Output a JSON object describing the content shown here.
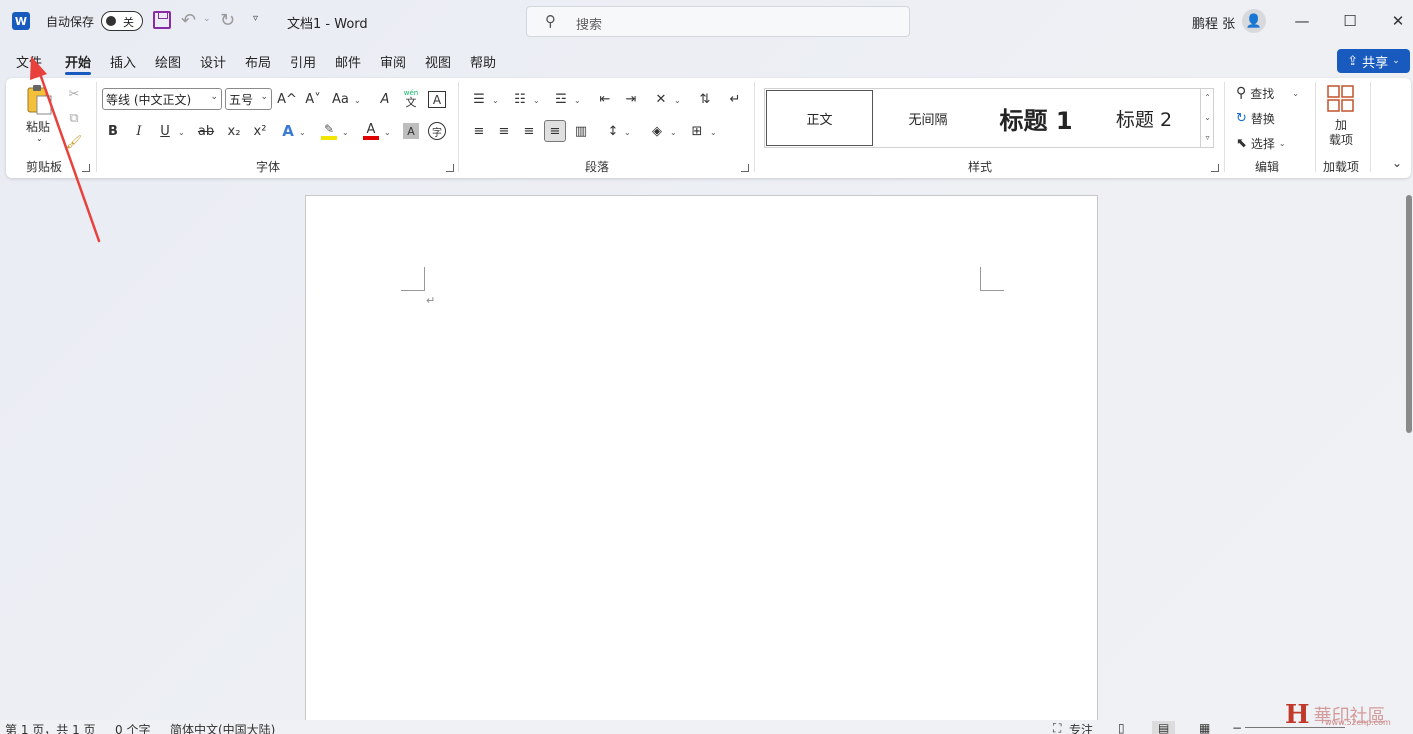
{
  "titlebar": {
    "app_logo": "W",
    "autosave_label": "自动保存",
    "autosave_state": "关",
    "doc_title": "文档1  -  Word",
    "search_placeholder": "搜索",
    "user_name": "鹏程 张",
    "icons": [
      "word-logo-icon",
      "save-icon",
      "undo-icon",
      "redo-icon",
      "search-icon",
      "avatar-icon",
      "minimize-icon",
      "maximize-icon",
      "close-icon"
    ]
  },
  "tabs": [
    "文件",
    "开始",
    "插入",
    "绘图",
    "设计",
    "布局",
    "引用",
    "邮件",
    "审阅",
    "视图",
    "帮助"
  ],
  "active_tab": "开始",
  "share_label": "共享",
  "ribbon": {
    "clipboard": {
      "paste_label": "粘贴",
      "group_label": "剪贴板"
    },
    "font": {
      "font_name": "等线 (中文正文)",
      "font_size": "五号",
      "grow": "A^",
      "shrink": "A˅",
      "case": "Aa",
      "phonetic_top": "wén",
      "phonetic_bottom": "文",
      "border_char": "A",
      "bold": "B",
      "italic": "I",
      "underline": "U",
      "strike": "ab",
      "subscript": "x₂",
      "superscript": "x²",
      "effects": "A",
      "font_color": "A",
      "shading": "A",
      "enclose": "字",
      "group_label": "字体",
      "highlight_color": "#f2e600",
      "font_color_hex": "#e00000"
    },
    "paragraph": {
      "group_label": "段落"
    },
    "styles": {
      "items": [
        "正文",
        "无间隔",
        "标题 1",
        "标题 2"
      ],
      "selected": "正文",
      "group_label": "样式"
    },
    "editing": {
      "find": "查找",
      "replace": "替换",
      "select": "选择",
      "group_label": "编辑"
    },
    "addins": {
      "button_label_1": "加",
      "button_label_2": "载项",
      "group_label": "加载项"
    }
  },
  "document": {
    "paragraph_mark": "↵"
  },
  "statusbar": {
    "page": "第 1 页，共 1 页",
    "words": "0 个字",
    "language": "简体中文(中国大陆)",
    "focus": "专注"
  },
  "watermark": {
    "logo": "H",
    "text": "華印社區",
    "sub": "www.52cnp.com"
  },
  "colors": {
    "accent": "#185abd",
    "annotation_arrow": "#e8413c"
  }
}
